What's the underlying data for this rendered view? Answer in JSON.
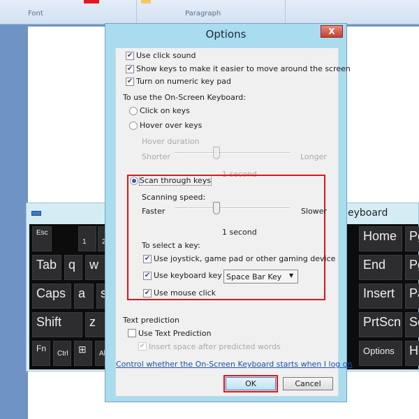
{
  "ribbon": {
    "groups": [
      "Font",
      "Paragraph"
    ]
  },
  "keyboard_window": {
    "title": "eyboard",
    "keys": {
      "left": [
        "Esc",
        "1",
        "2",
        "Tab",
        "q",
        "w",
        "Caps",
        "a",
        "s",
        "Shift",
        "z",
        "Fn",
        "Ctrl",
        "Alt"
      ],
      "right": [
        "Home",
        "Pg",
        "End",
        "Pg",
        "Insert",
        "Pa",
        "PrtScn",
        "Sc",
        "Options",
        "He"
      ]
    }
  },
  "dialog": {
    "title": "Options",
    "close": "X",
    "options": [
      {
        "label": "Use click sound",
        "checked": true
      },
      {
        "label": "Show keys to make it easier to move around the screen",
        "checked": true
      },
      {
        "label": "Turn on numeric key pad",
        "checked": true
      }
    ],
    "mode_heading": "To use the On-Screen Keyboard:",
    "modes": [
      {
        "label": "Click on keys",
        "selected": false
      },
      {
        "label": "Hover over keys",
        "selected": false
      },
      {
        "label": "Scan through keys",
        "selected": true
      }
    ],
    "hover": {
      "label": "Hover duration",
      "min": "Shorter",
      "max": "Longer",
      "value": "1 second"
    },
    "scan": {
      "label": "Scanning speed:",
      "min": "Faster",
      "max": "Slower",
      "value": "1 second"
    },
    "select_heading": "To select a key:",
    "select_options": [
      {
        "label": "Use joystick, game pad or other gaming device",
        "checked": true
      },
      {
        "label": "Use keyboard key",
        "checked": true
      },
      {
        "label": "Use mouse click",
        "checked": true
      }
    ],
    "keyboard_key_select": "Space Bar Key",
    "text_prediction": {
      "heading": "Text prediction",
      "use": "Use Text Prediction",
      "use_checked": false,
      "insert_space": "Insert space after predicted words",
      "insert_checked": true
    },
    "link": "Control whether the On-Screen Keyboard starts when I log on",
    "ok": "OK",
    "cancel": "Cancel"
  },
  "colors": {
    "highlight": "#e0141e",
    "title_bar": "#a9dcee"
  }
}
